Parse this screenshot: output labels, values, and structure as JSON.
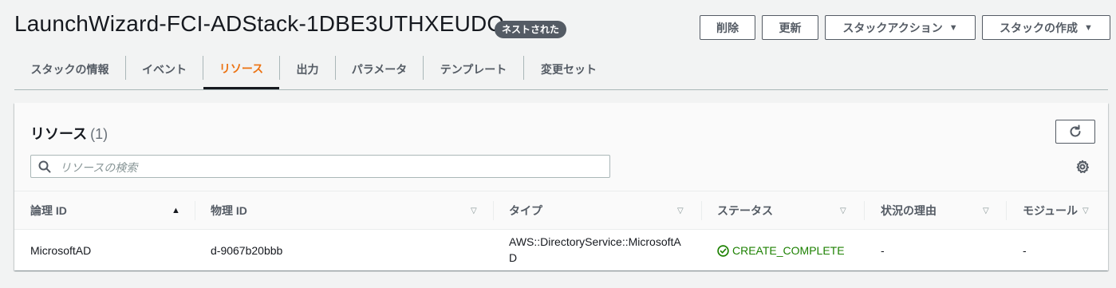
{
  "header": {
    "stack_name": "LaunchWizard-FCI-ADStack-1DBE3UTHXEUDO",
    "badge": "ネストされた",
    "buttons": {
      "delete": "削除",
      "update": "更新",
      "stack_actions": "スタックアクション",
      "create_stack": "スタックの作成"
    }
  },
  "tabs": [
    "スタックの情報",
    "イベント",
    "リソース",
    "出力",
    "パラメータ",
    "テンプレート",
    "変更セット"
  ],
  "active_tab": "リソース",
  "resources": {
    "title": "リソース",
    "count": "(1)",
    "search_placeholder": "リソースの検索",
    "columns": [
      "論理 ID",
      "物理 ID",
      "タイプ",
      "ステータス",
      "状況の理由",
      "モジュール"
    ],
    "rows": [
      {
        "logical_id": "MicrosoftAD",
        "physical_id": "d-9067b20bbb",
        "type_line1": "AWS::DirectoryService::MicrosoftA",
        "type_line2": "D",
        "status": "CREATE_COMPLETE",
        "reason": "-",
        "module": "-"
      }
    ]
  },
  "colors": {
    "accent": "#ec7211",
    "success": "#1d8102",
    "badge_bg": "#545b64"
  }
}
